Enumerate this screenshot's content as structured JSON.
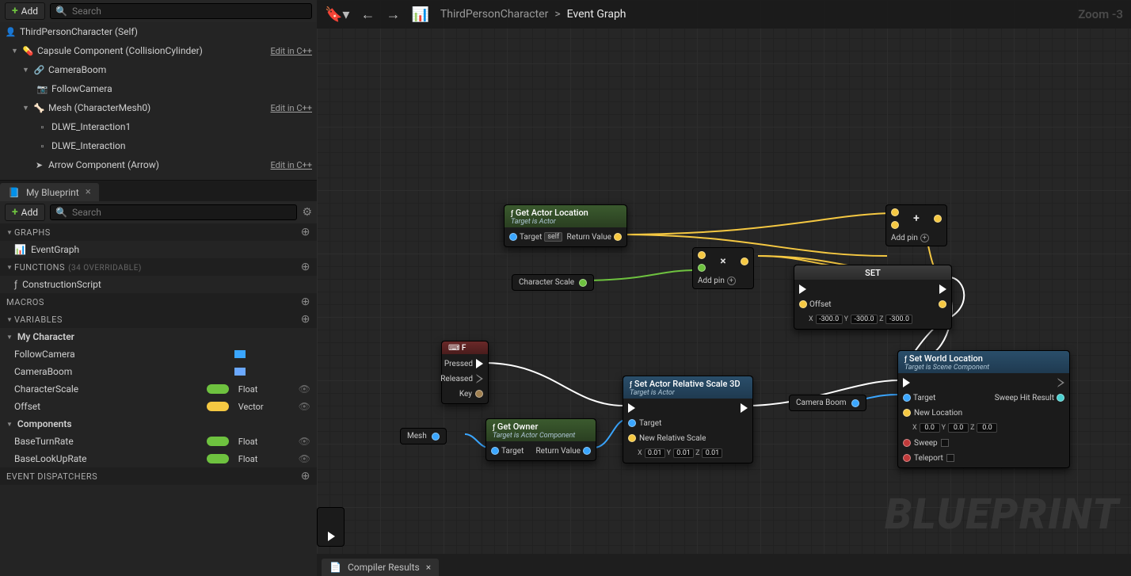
{
  "toolbar": {
    "add": "Add",
    "search_ph": "Search"
  },
  "components": [
    {
      "label": "ThirdPersonCharacter (Self)",
      "indent": 0,
      "icon": "pawn",
      "arrow": "",
      "edit": false
    },
    {
      "label": "Capsule Component (CollisionCylinder)",
      "indent": 1,
      "icon": "capsule",
      "arrow": "▼",
      "edit": true
    },
    {
      "label": "CameraBoom",
      "indent": 2,
      "icon": "boom",
      "arrow": "▼",
      "edit": false
    },
    {
      "label": "FollowCamera",
      "indent": 3,
      "icon": "camera",
      "arrow": "",
      "edit": false
    },
    {
      "label": "Mesh (CharacterMesh0)",
      "indent": 2,
      "icon": "mesh",
      "arrow": "▼",
      "edit": true
    },
    {
      "label": "DLWE_Interaction1",
      "indent": 3,
      "icon": "sub",
      "arrow": "",
      "edit": false
    },
    {
      "label": "DLWE_Interaction",
      "indent": 3,
      "icon": "sub",
      "arrow": "",
      "edit": false
    },
    {
      "label": "Arrow Component (Arrow)",
      "indent": 2,
      "icon": "arrowc",
      "arrow": "",
      "edit": true
    }
  ],
  "tab": {
    "title": "My Blueprint"
  },
  "sections": {
    "graphs": "GRAPHS",
    "eventgraph": "EventGraph",
    "functions": "FUNCTIONS",
    "functions_sub": "(34 OVERRIDABLE)",
    "construction": "ConstructionScript",
    "macros": "MACROS",
    "variables": "VARIABLES",
    "mychar": "My Character",
    "components_var": "Components",
    "dispatch": "EVENT DISPATCHERS"
  },
  "vars": {
    "followcam": {
      "name": "FollowCamera"
    },
    "camboom": {
      "name": "CameraBoom"
    },
    "charscale": {
      "name": "CharacterScale",
      "type": "Float"
    },
    "offset": {
      "name": "Offset",
      "type": "Vector"
    },
    "baseturn": {
      "name": "BaseTurnRate",
      "type": "Float"
    },
    "baselook": {
      "name": "BaseLookUpRate",
      "type": "Float"
    }
  },
  "edit_cpp": "Edit in C++",
  "breadcrumb": {
    "a": "ThirdPersonCharacter",
    "sep": ">",
    "b": "Event Graph"
  },
  "zoom": "Zoom -3",
  "watermark": "BLUEPRINT",
  "bottomtab": "Compiler Results",
  "nodes": {
    "getactorloc": {
      "title": "Get Actor Location",
      "sub": "Target is Actor",
      "target": "Target",
      "self": "self",
      "retval": "Return Value"
    },
    "charscale": {
      "label": "Character Scale"
    },
    "multiply": {
      "sym": "×",
      "addpin": "Add pin"
    },
    "add": {
      "sym": "+",
      "addpin": "Add pin"
    },
    "set": {
      "title": "SET",
      "offset": "Offset",
      "x": "-300.0",
      "y": "-300.0",
      "z": "-300.0"
    },
    "inputF": {
      "title": "F",
      "pressed": "Pressed",
      "released": "Released",
      "key": "Key"
    },
    "mesh": {
      "label": "Mesh"
    },
    "getowner": {
      "title": "Get Owner",
      "sub": "Target is Actor Component",
      "target": "Target",
      "retval": "Return Value"
    },
    "setscale": {
      "title": "Set Actor Relative Scale 3D",
      "sub": "Target is Actor",
      "target": "Target",
      "nrs": "New Relative Scale",
      "x": "0.01",
      "y": "0.01",
      "z": "0.01"
    },
    "camboom": {
      "label": "Camera Boom"
    },
    "setworld": {
      "title": "Set World Location",
      "sub": "Target is Scene Component",
      "target": "Target",
      "newloc": "New Location",
      "x": "0.0",
      "y": "0.0",
      "z": "0.0",
      "sweep": "Sweep",
      "teleport": "Teleport",
      "hit": "Sweep Hit Result"
    }
  }
}
